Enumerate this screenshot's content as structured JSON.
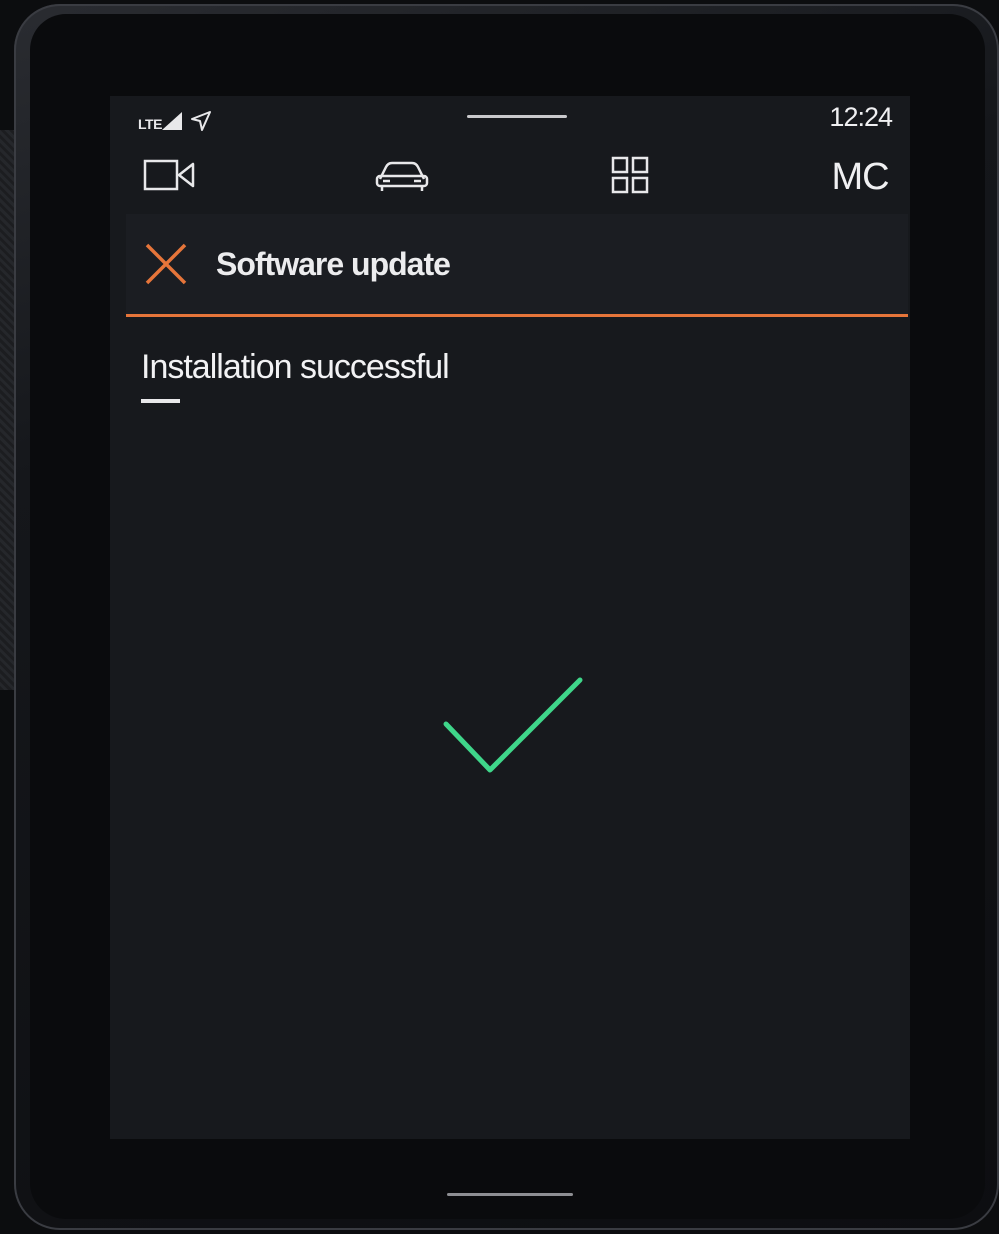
{
  "status_bar": {
    "network": "LTE",
    "time": "12:24"
  },
  "nav": {
    "camera_icon": "video-camera-icon",
    "car_icon": "car-icon",
    "apps_icon": "app-grid-icon",
    "profile_initials": "MC"
  },
  "header": {
    "close_icon": "close-x-icon",
    "title": "Software update"
  },
  "content": {
    "status_text": "Installation successful",
    "result_icon": "checkmark-icon"
  },
  "colors": {
    "accent": "#e6753a",
    "success": "#3fd68a",
    "background": "#17191d"
  }
}
